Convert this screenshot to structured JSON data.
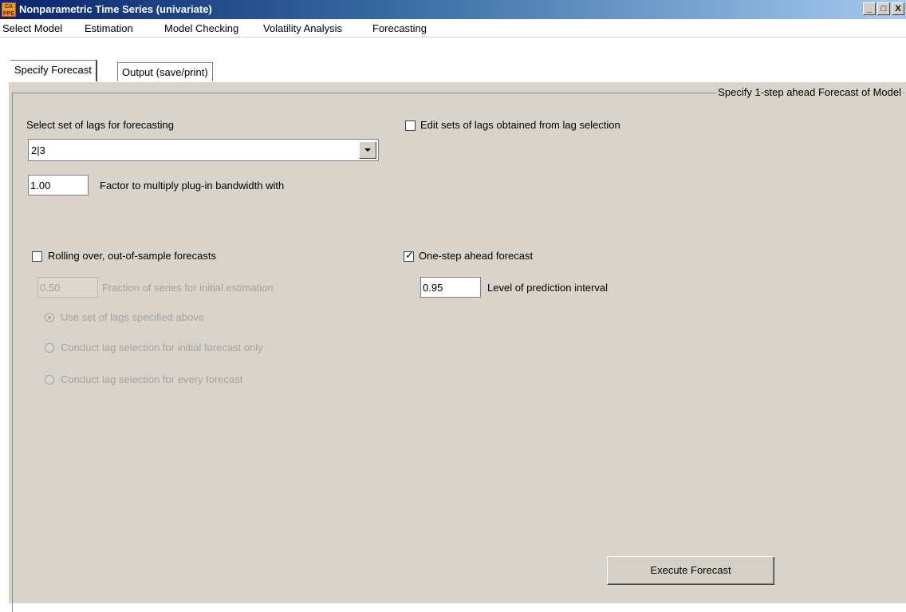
{
  "window": {
    "title": "Nonparametric Time Series (univariate)",
    "logo_text": "CA PPE",
    "minimize_label": "_",
    "maximize_label": "□",
    "close_label": "X"
  },
  "menu": [
    "Select Model",
    "Estimation",
    "Model Checking",
    "Volatility Analysis",
    "Forecasting"
  ],
  "tabs": [
    "Specify Forecast",
    "Output (save/print)"
  ],
  "panel": {
    "frame_title": "Specify 1-step ahead Forecast of Model",
    "lag_select_label": "Select set of lags for forecasting",
    "lag_select_value": "2|3",
    "bandwidth_value": "1.00",
    "bandwidth_label": "Factor to multiply plug-in bandwidth with",
    "edit_lags_label": "Edit sets of lags obtained from lag selection",
    "edit_lags_checked": false,
    "rolling_label": "Rolling over, out-of-sample forecasts",
    "rolling_checked": false,
    "fraction_value": "0.50",
    "fraction_label": "Fraction of series for initial estimation",
    "radio_options": [
      "Use set of lags specified above",
      "Conduct lag selection for initial forecast only",
      "Conduct lag selection for every forecast"
    ],
    "radio_selected": 0,
    "one_step_label": "One-step ahead forecast",
    "one_step_checked": true,
    "level_value": "0.95",
    "level_label": "Level of prediction interval",
    "execute_label": "Execute Forecast"
  },
  "colors": {
    "titlebar_start": "#0a246a",
    "titlebar_end": "#a6caf0",
    "panel_bg": "#d8d4cc",
    "disabled_text": "#a6a29a"
  }
}
